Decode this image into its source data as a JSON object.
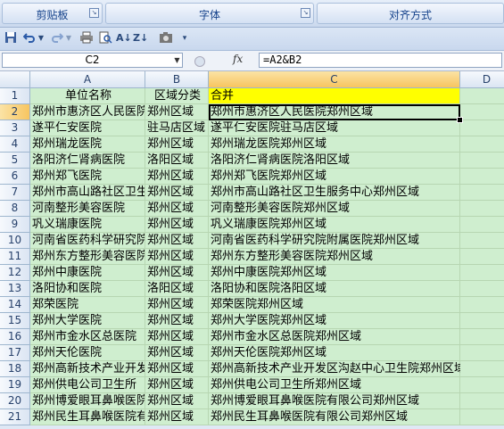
{
  "ribbon": {
    "groups": [
      {
        "label": "剪贴板"
      },
      {
        "label": "字体"
      },
      {
        "label": "对齐方式"
      }
    ]
  },
  "qat": {
    "icons": [
      "save-icon",
      "undo-icon",
      "undo-dropdown-icon",
      "redo-icon",
      "redo-dropdown-icon",
      "print-icon",
      "print-preview-icon",
      "sort-asc-icon",
      "sort-desc-icon",
      "camera-icon",
      "customize-qat-icon"
    ]
  },
  "formula_bar": {
    "name_box": "C2",
    "fx_label": "fx",
    "formula": "=A2&B2"
  },
  "columns": [
    "A",
    "B",
    "C",
    "D"
  ],
  "selected_column": "C",
  "header_row": {
    "row": "1",
    "a": "单位名称",
    "b": "区域分类",
    "c": "合并",
    "d": ""
  },
  "rows": [
    {
      "row": "2",
      "a": "郑州市惠济区人民医院",
      "b": "郑州区域",
      "c": "郑州市惠济区人民医院郑州区域"
    },
    {
      "row": "3",
      "a": "遂平仁安医院",
      "b": "驻马店区域",
      "c": "遂平仁安医院驻马店区域"
    },
    {
      "row": "4",
      "a": "郑州瑞龙医院",
      "b": "郑州区域",
      "c": "郑州瑞龙医院郑州区域"
    },
    {
      "row": "5",
      "a": "洛阳济仁肾病医院",
      "b": "洛阳区域",
      "c": "洛阳济仁肾病医院洛阳区域"
    },
    {
      "row": "6",
      "a": "郑州郑飞医院",
      "b": "郑州区域",
      "c": "郑州郑飞医院郑州区域"
    },
    {
      "row": "7",
      "a": "郑州市高山路社区卫生服务中心",
      "b": "郑州区域",
      "c": "郑州市高山路社区卫生服务中心郑州区域"
    },
    {
      "row": "8",
      "a": "河南整形美容医院",
      "b": "郑州区域",
      "c": "河南整形美容医院郑州区域"
    },
    {
      "row": "9",
      "a": "巩义瑞康医院",
      "b": "郑州区域",
      "c": "巩义瑞康医院郑州区域"
    },
    {
      "row": "10",
      "a": "河南省医药科学研究院附属医院",
      "b": "郑州区域",
      "c": "河南省医药科学研究院附属医院郑州区域"
    },
    {
      "row": "11",
      "a": "郑州东方整形美容医院",
      "b": "郑州区域",
      "c": "郑州东方整形美容医院郑州区域"
    },
    {
      "row": "12",
      "a": "郑州中康医院",
      "b": "郑州区域",
      "c": "郑州中康医院郑州区域"
    },
    {
      "row": "13",
      "a": "洛阳协和医院",
      "b": "洛阳区域",
      "c": "洛阳协和医院洛阳区域"
    },
    {
      "row": "14",
      "a": "郑荣医院",
      "b": "郑州区域",
      "c": "郑荣医院郑州区域"
    },
    {
      "row": "15",
      "a": "郑州大学医院",
      "b": "郑州区域",
      "c": "郑州大学医院郑州区域"
    },
    {
      "row": "16",
      "a": "郑州市金水区总医院",
      "b": "郑州区域",
      "c": "郑州市金水区总医院郑州区域"
    },
    {
      "row": "17",
      "a": "郑州天伦医院",
      "b": "郑州区域",
      "c": "郑州天伦医院郑州区域"
    },
    {
      "row": "18",
      "a": "郑州高新技术产业开发区沟赵中心卫生院",
      "b": "郑州区域",
      "c": "郑州高新技术产业开发区沟赵中心卫生院郑州区域"
    },
    {
      "row": "19",
      "a": "郑州供电公司卫生所",
      "b": "郑州区域",
      "c": "郑州供电公司卫生所郑州区域"
    },
    {
      "row": "20",
      "a": "郑州博爱眼耳鼻喉医院有限公司",
      "b": "郑州区域",
      "c": "郑州博爱眼耳鼻喉医院有限公司郑州区域"
    },
    {
      "row": "21",
      "a": "郑州民生耳鼻喉医院有限公司",
      "b": "郑州区域",
      "c": "郑州民生耳鼻喉医院有限公司郑州区域"
    }
  ],
  "colors": {
    "cell_fill": "#cfeecf",
    "header_fill": "#ffff00",
    "selection_header": "#f7c560"
  }
}
